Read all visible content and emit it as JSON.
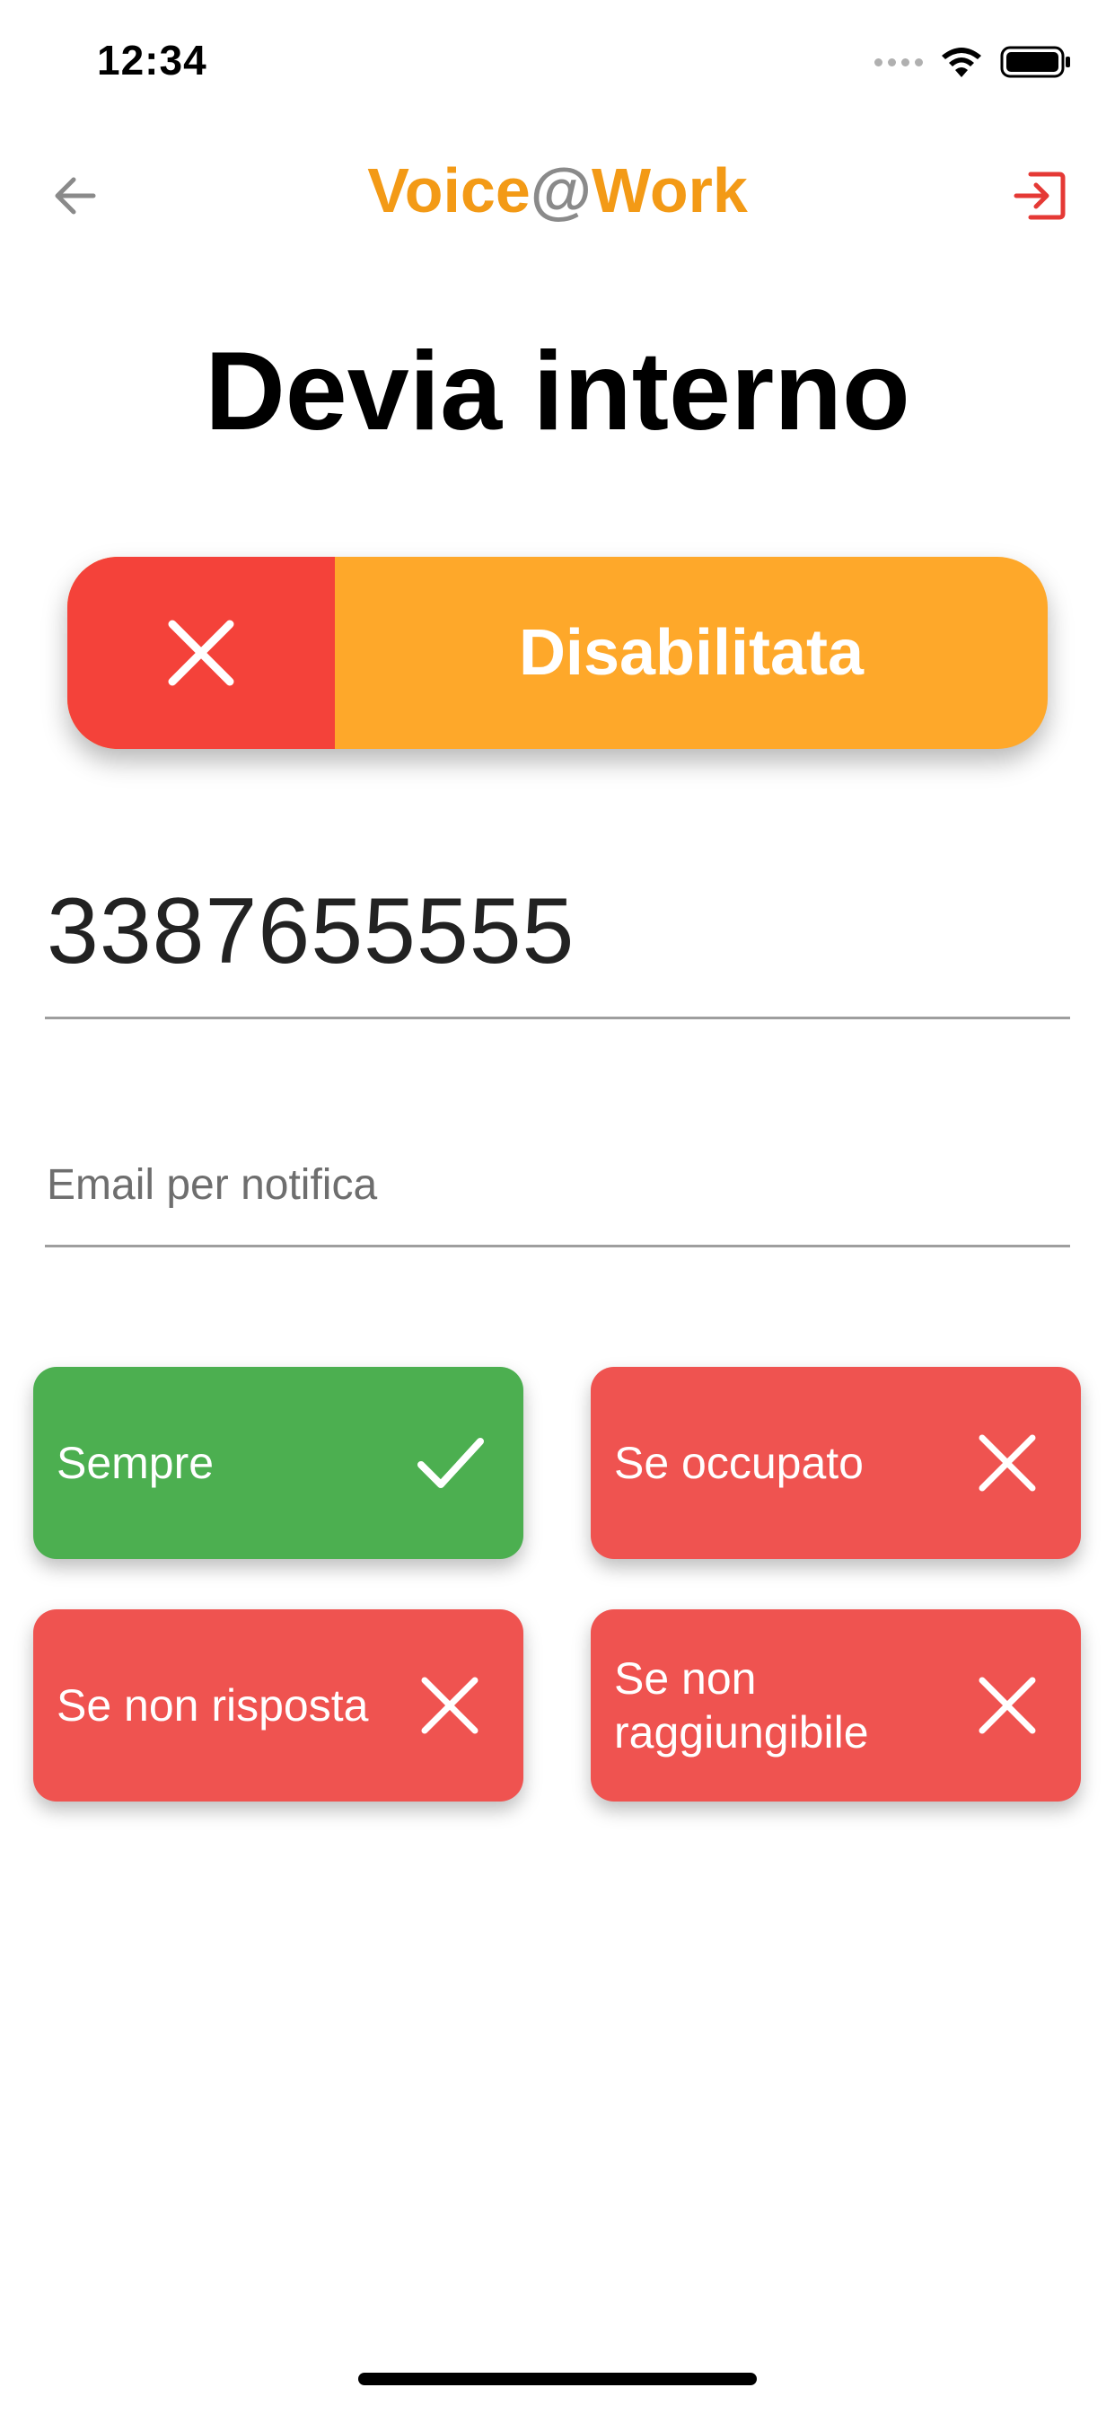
{
  "status_bar": {
    "time": "12:34",
    "icons": [
      "signal-icon",
      "wifi-icon",
      "battery-icon"
    ]
  },
  "nav": {
    "back_icon": "arrow-left-icon",
    "title_part1": "Voice",
    "title_at": "@",
    "title_part2": "Work",
    "logout_icon": "logout-icon"
  },
  "page": {
    "title": "Devia interno"
  },
  "status_toggle": {
    "state": false,
    "icon": "close-icon",
    "label": "Disabilitata"
  },
  "phone": {
    "value": "3387655555"
  },
  "email": {
    "placeholder": "Email per notifica",
    "value": ""
  },
  "options": [
    {
      "label": "Sempre",
      "enabled": true,
      "icon": "check-icon"
    },
    {
      "label": "Se occupato",
      "enabled": false,
      "icon": "close-icon"
    },
    {
      "label": "Se non risposta",
      "enabled": false,
      "icon": "close-icon"
    },
    {
      "label": "Se non raggiungibile",
      "enabled": false,
      "icon": "close-icon"
    }
  ],
  "colors": {
    "brand_orange": "#f39a16",
    "toggle_red": "#f4423a",
    "toggle_orange": "#fea82a",
    "option_on": "#4caf50",
    "option_off": "#ef5350",
    "logout_red": "#e53935"
  }
}
